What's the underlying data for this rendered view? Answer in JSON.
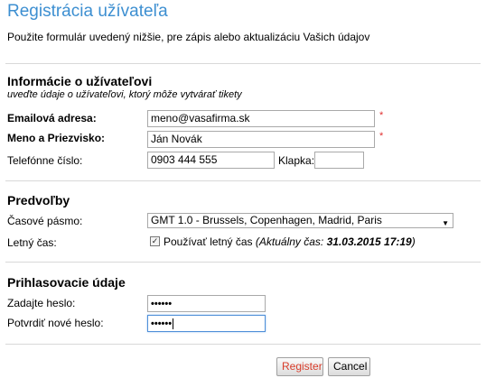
{
  "page": {
    "title": "Registrácia užívateľa",
    "intro": "Použite formulár uvedený nižšie, pre zápis alebo aktualizáciu Vašich údajov"
  },
  "user_info": {
    "heading": "Informácie o užívateľovi",
    "subheading": "uveďte údaje o užívateľovi, ktorý môže vytvárať tikety",
    "email_label": "Emailová adresa:",
    "email_value": "meno@vasafirma.sk",
    "name_label": "Meno a Priezvisko:",
    "name_value": "Ján Novák",
    "required_mark": "*",
    "phone_label": "Telefónne číslo:",
    "phone_value": "0903 444 555",
    "ext_label": "Klapka:",
    "ext_value": ""
  },
  "preferences": {
    "heading": "Predvoľby",
    "timezone_label": "Časové pásmo:",
    "timezone_value": "GMT 1.0 - Brussels, Copenhagen, Madrid, Paris",
    "dst_label": "Letný čas:",
    "dst_checkbox_label": "Používať letný čas",
    "dst_current_prefix": "(Aktuálny čas:",
    "dst_current_time": "31.03.2015 17:19",
    "dst_current_suffix": ")",
    "dst_checked": true
  },
  "login": {
    "heading": "Prihlasovacie údaje",
    "password_label": "Zadajte heslo:",
    "password_value": "••••••",
    "confirm_label": "Potvrdiť nové heslo:",
    "confirm_value": "••••••"
  },
  "actions": {
    "register_label": "Register",
    "cancel_label": "Cancel"
  },
  "colors": {
    "title": "#3d8fd1",
    "required": "#e03030",
    "register_text": "#d83c2a"
  }
}
